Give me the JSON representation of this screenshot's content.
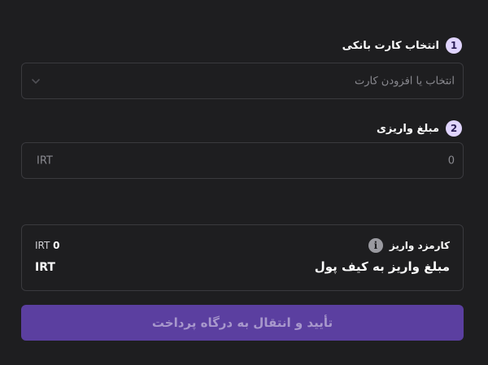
{
  "step1": {
    "number": "1",
    "label": "انتخاب کارت بانکی",
    "placeholder": "انتخاب یا افزودن کارت"
  },
  "step2": {
    "number": "2",
    "label": "مبلغ واریزی",
    "value": "0",
    "currency": "IRT"
  },
  "summary": {
    "fee_label": "کارمزد واریز",
    "fee_amount": "0",
    "fee_currency": "IRT",
    "total_label": "مبلغ واریز به کیف پول",
    "total_currency": "IRT"
  },
  "submit": {
    "label": "تأیید و انتقال به درگاه پرداخت"
  },
  "colors": {
    "background": "#1e1e20",
    "border": "#3a3a3e",
    "step_badge": "#e0d4ff",
    "button": "#5b3fa0",
    "button_text": "#a898cc"
  }
}
